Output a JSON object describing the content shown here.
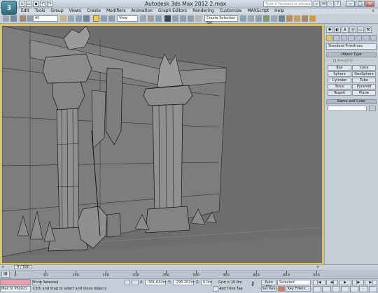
{
  "app": {
    "logo": "3",
    "title": "Autodesk 3ds Max  2012      2.max",
    "search_placeholder": "Type a keyword or phrase"
  },
  "menu": [
    "Edit",
    "Tools",
    "Group",
    "Views",
    "Create",
    "Modifiers",
    "Animation",
    "Graph Editors",
    "Rendering",
    "Customize",
    "MAXScript",
    "Help"
  ],
  "toolbar": {
    "selection_filter": "All",
    "reference_coord": "View",
    "named_selection": "Create Selection Set"
  },
  "command_panel": {
    "category": "Standard Primitives",
    "rollout_object_type": "Object Type",
    "autogrid": "AutoGrid",
    "object_buttons": [
      "Box",
      "Cone",
      "Sphere",
      "GeoSphere",
      "Cylinder",
      "Tube",
      "Torus",
      "Pyramid",
      "Teapot",
      "Plane"
    ],
    "rollout_name_color": "Name and Color"
  },
  "timeline": {
    "slider": "0 / 500",
    "ticks": [
      "0",
      "50",
      "100",
      "150",
      "200",
      "250",
      "300",
      "350",
      "400",
      "450",
      "500"
    ]
  },
  "status": {
    "maxscript_text": "Max to Physics",
    "selection_status": "None Selected",
    "prompt": "Click and drag to select and move objects",
    "x_label": "X:",
    "x_value": "-361.644m",
    "y_label": "Y:",
    "y_value": "-295.202m",
    "z_label": "Z:",
    "z_value": "0.0m",
    "grid": "Grid = 10.0m",
    "add_time_tag": "Add Time Tag",
    "auto_key": "Auto Key",
    "set_key": "Set Key",
    "selected": "Selected",
    "key_filters": "Key Filters..."
  },
  "colors": {
    "viewport_border": "#e7c43a",
    "viewport_bg": "#6d6e70",
    "ui_bg": "#c6ced7"
  }
}
